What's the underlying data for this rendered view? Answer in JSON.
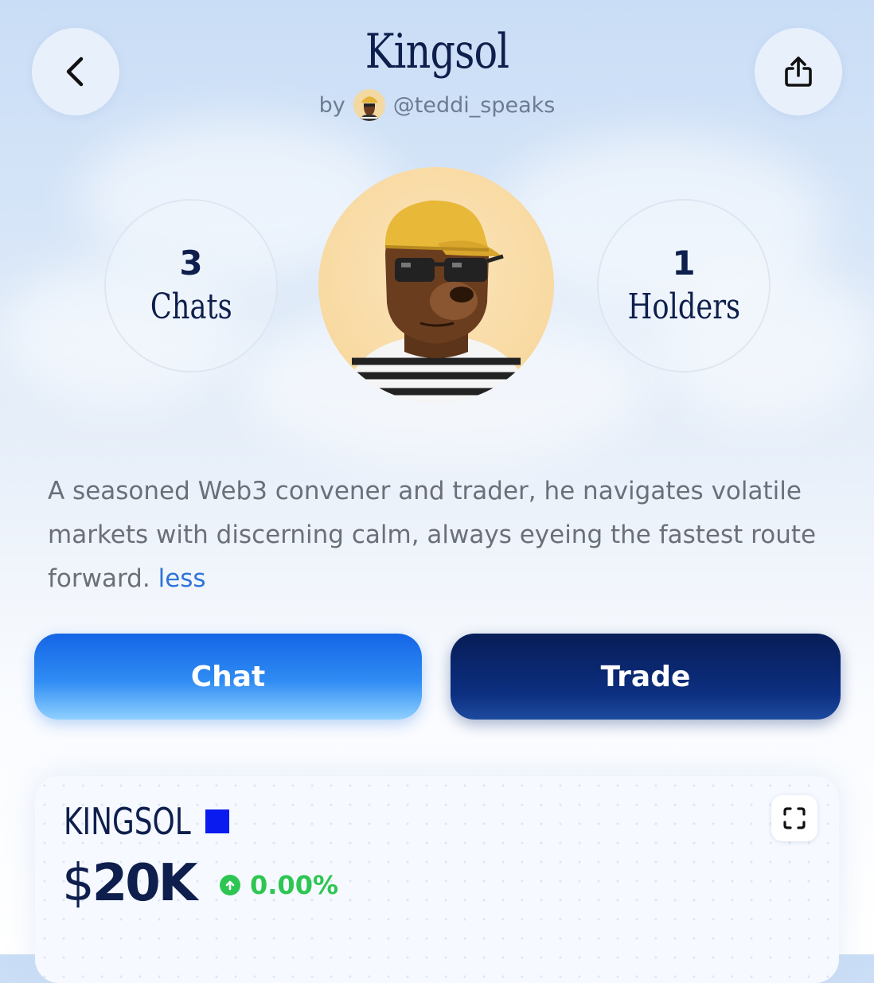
{
  "header": {
    "title": "Kingsol",
    "by_label": "by",
    "creator_handle": "@teddi_speaks",
    "back_icon": "chevron-left-icon",
    "share_icon": "share-icon"
  },
  "stats": {
    "chats": {
      "value": "3",
      "label": "Chats"
    },
    "holders": {
      "value": "1",
      "label": "Holders"
    }
  },
  "description": {
    "text": "A seasoned Web3 convener and trader, he navigates volatile markets with discerning calm, always eyeing the fastest route forward.",
    "toggle": "less"
  },
  "actions": {
    "chat_label": "Chat",
    "trade_label": "Trade"
  },
  "market": {
    "ticker": "KINGSOL",
    "price_symbol": "$",
    "price_value": "20K",
    "change": "0.00%",
    "change_direction": "up",
    "expand_icon": "expand-icon"
  },
  "colors": {
    "navy": "#0e1f4d",
    "chat_button": "#1f78ee",
    "trade_button": "#0a2566",
    "positive": "#2dc653",
    "link": "#2f74d8",
    "ticker_square": "#0a1bf0"
  }
}
